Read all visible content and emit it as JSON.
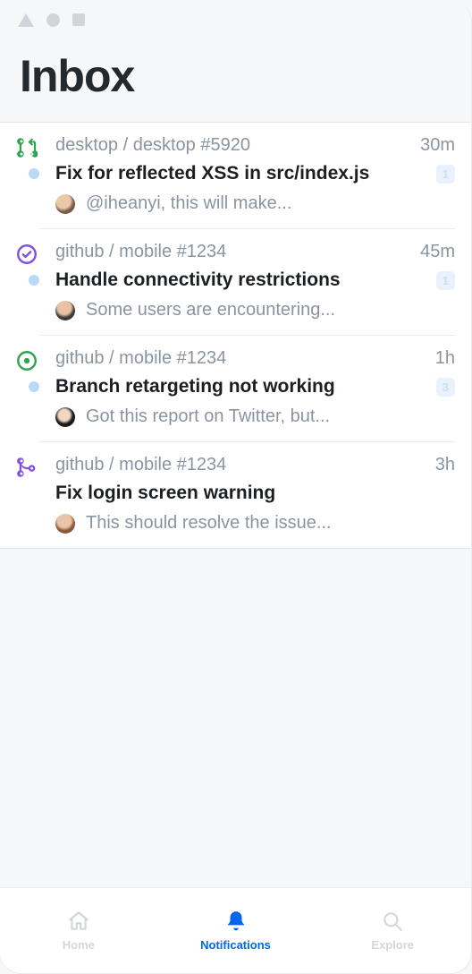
{
  "header": {
    "title": "Inbox"
  },
  "items": [
    {
      "type": "pr",
      "iconColor": "#2da44e",
      "repo": "desktop / desktop #5920",
      "time": "30m",
      "unread": true,
      "title": "Fix for reflected XSS in src/index.js",
      "badge": "1",
      "avatarClass": "a1",
      "preview": "@iheanyi, this will make..."
    },
    {
      "type": "check",
      "iconColor": "#8250df",
      "repo": "github / mobile #1234",
      "time": "45m",
      "unread": true,
      "title": "Handle connectivity restrictions",
      "badge": "1",
      "avatarClass": "a2",
      "preview": "Some users are encountering..."
    },
    {
      "type": "issue",
      "iconColor": "#2da44e",
      "repo": "github / mobile #1234",
      "time": "1h",
      "unread": true,
      "title": "Branch retargeting not working",
      "badge": "3",
      "avatarClass": "a3",
      "preview": "Got this report on Twitter, but..."
    },
    {
      "type": "merged",
      "iconColor": "#8250df",
      "repo": "github / mobile #1234",
      "time": "3h",
      "unread": false,
      "title": "Fix login screen warning",
      "badge": null,
      "avatarClass": "a4",
      "preview": "This should resolve the issue..."
    }
  ],
  "tabs": {
    "home": "Home",
    "notifications": "Notifications",
    "explore": "Explore"
  }
}
